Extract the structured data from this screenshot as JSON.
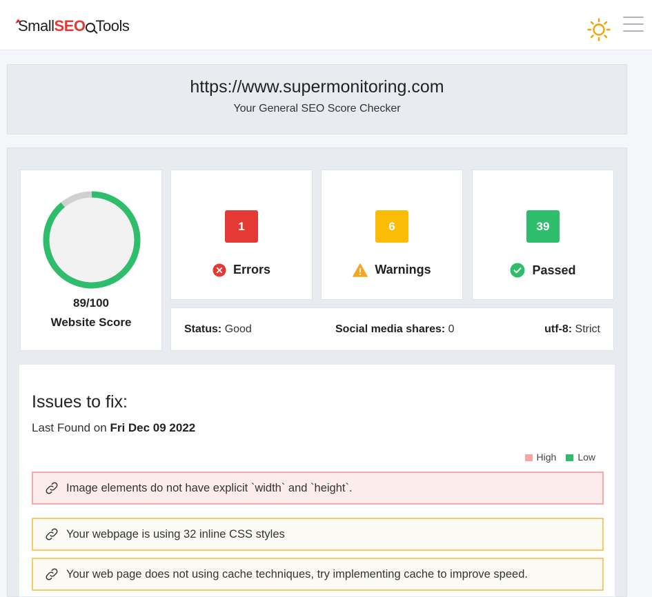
{
  "header": {
    "logo_small": "Small",
    "logo_seo": "SEO",
    "logo_tools": "Tools",
    "theme_icon": "sun-icon",
    "menu_icon": "hamburger-menu-icon"
  },
  "target": {
    "url": "https://www.supermonitoring.com",
    "subtitle": "Your General SEO Score Checker"
  },
  "score": {
    "value_text": "89/100",
    "value": 89,
    "max": 100,
    "label": "Website Score",
    "ring_color": "#2ebd6b",
    "track_color": "#d0d0d0"
  },
  "stats": [
    {
      "count": "1",
      "label": "Errors",
      "color": "#e53935",
      "icon": "error-x-icon"
    },
    {
      "count": "6",
      "label": "Warnings",
      "color": "#fbbc05",
      "icon": "warning-triangle-icon"
    },
    {
      "count": "39",
      "label": "Passed",
      "color": "#2ebd6b",
      "icon": "check-circle-icon"
    }
  ],
  "info": {
    "status_label": "Status:",
    "status_value": "Good",
    "shares_label": "Social media shares:",
    "shares_value": "0",
    "charset_label": "utf-8:",
    "charset_value": "Strict"
  },
  "issues": {
    "title": "Issues to fix:",
    "last_found_prefix": "Last Found on",
    "last_found_date": "Fri Dec 09 2022",
    "legend_high": "High",
    "legend_low": "Low",
    "legend_high_color": "#f6a5a5",
    "legend_low_color": "#2ebd6b",
    "items": [
      {
        "text": "Image elements do not have explicit `width` and `height`.",
        "severity": "high"
      },
      {
        "text": "Your webpage is using 32 inline CSS styles",
        "severity": "low"
      },
      {
        "text": "Your web page does not using cache techniques, try implementing cache to improve speed.",
        "severity": "low"
      }
    ]
  }
}
